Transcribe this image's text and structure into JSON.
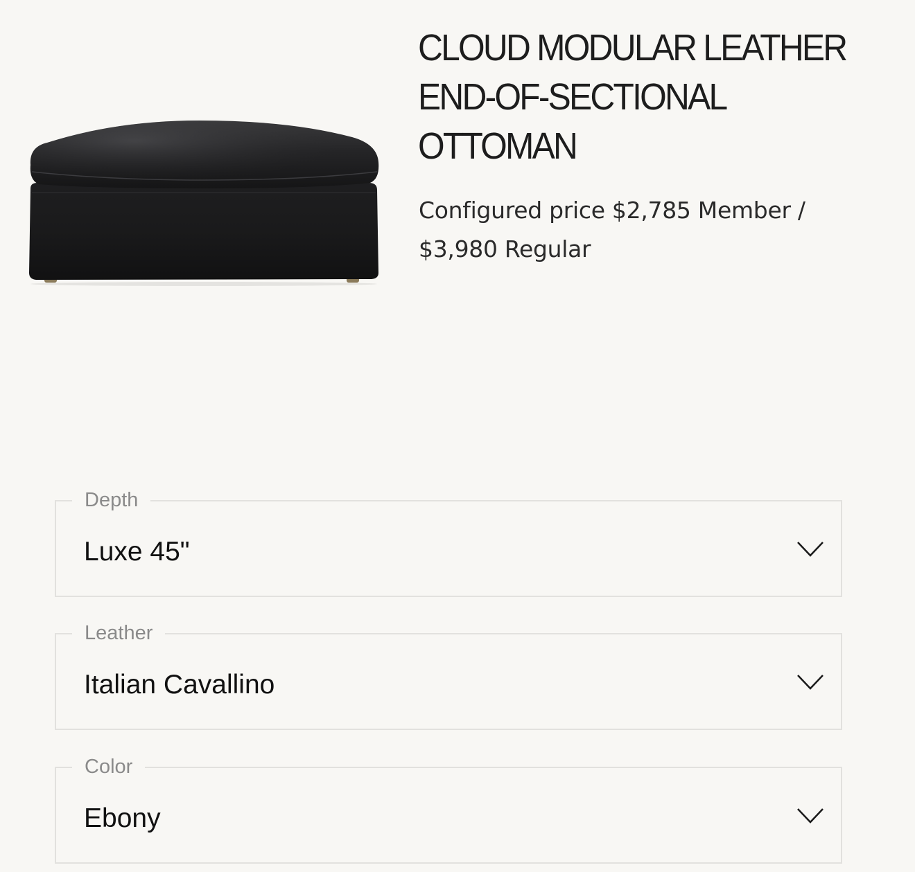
{
  "product": {
    "title": "CLOUD MODULAR LEATHER END-OF-SECTIONAL OTTOMAN",
    "price_prefix": "Configured price",
    "member_price": "$2,785 Member /",
    "regular_price": "$3,980 Regular",
    "image_alt": "black leather ottoman"
  },
  "options": [
    {
      "label": "Depth",
      "value": "Luxe 45\"",
      "icon": "chevron-down-icon"
    },
    {
      "label": "Leather",
      "value": "Italian Cavallino",
      "icon": "chevron-down-icon"
    },
    {
      "label": "Color",
      "value": "Ebony",
      "icon": "chevron-down-icon"
    }
  ],
  "colors": {
    "background": "#f8f7f4",
    "border": "#e2e1de",
    "label": "#8a8a8a",
    "text": "#111111"
  }
}
